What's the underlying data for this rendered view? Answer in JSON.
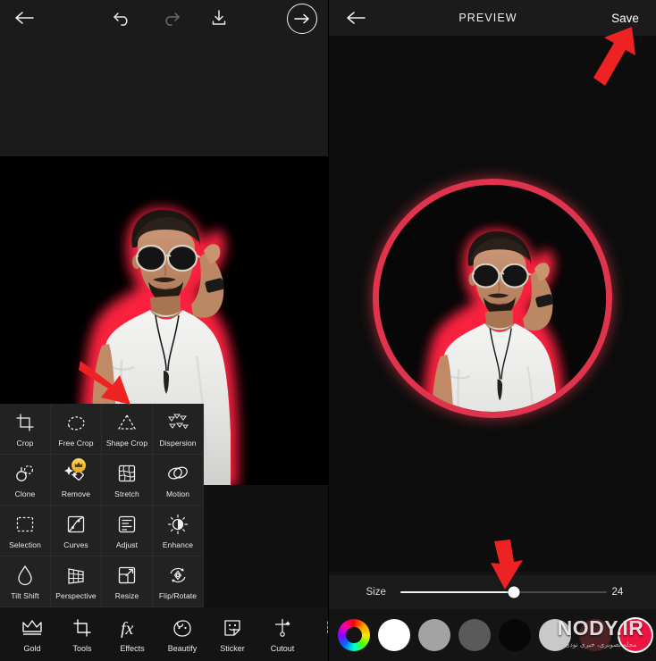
{
  "left_screen": {
    "toolbar": {
      "back_icon": "back-arrow-icon",
      "undo_icon": "undo-icon",
      "redo_icon": "redo-icon",
      "download_icon": "download-icon",
      "next_icon": "forward-arrow-circle-icon"
    },
    "tools_panel": {
      "items": [
        {
          "label": "Crop",
          "icon": "crop-icon",
          "premium": false
        },
        {
          "label": "Free Crop",
          "icon": "free-crop-icon",
          "premium": false
        },
        {
          "label": "Shape Crop",
          "icon": "shape-crop-icon",
          "premium": false
        },
        {
          "label": "Dispersion",
          "icon": "dispersion-icon",
          "premium": false
        },
        {
          "label": "Clone",
          "icon": "clone-icon",
          "premium": false
        },
        {
          "label": "Remove",
          "icon": "remove-icon",
          "premium": true
        },
        {
          "label": "Stretch",
          "icon": "stretch-icon",
          "premium": false
        },
        {
          "label": "Motion",
          "icon": "motion-icon",
          "premium": false
        },
        {
          "label": "Selection",
          "icon": "selection-icon",
          "premium": false
        },
        {
          "label": "Curves",
          "icon": "curves-icon",
          "premium": false
        },
        {
          "label": "Adjust",
          "icon": "adjust-icon",
          "premium": false
        },
        {
          "label": "Enhance",
          "icon": "enhance-icon",
          "premium": false
        },
        {
          "label": "Tilt Shift",
          "icon": "tilt-shift-icon",
          "premium": false
        },
        {
          "label": "Perspective",
          "icon": "perspective-icon",
          "premium": false
        },
        {
          "label": "Resize",
          "icon": "resize-icon",
          "premium": false
        },
        {
          "label": "Flip/Rotate",
          "icon": "flip-rotate-icon",
          "premium": false
        }
      ]
    },
    "bottom_nav": {
      "items": [
        {
          "label": "Gold",
          "icon": "crown-icon"
        },
        {
          "label": "Tools",
          "icon": "tools-icon"
        },
        {
          "label": "Effects",
          "icon": "fx-icon"
        },
        {
          "label": "Beautify",
          "icon": "beautify-icon"
        },
        {
          "label": "Sticker",
          "icon": "sticker-icon"
        },
        {
          "label": "Cutout",
          "icon": "cutout-icon"
        },
        {
          "label": "T",
          "icon": "text-icon"
        }
      ]
    }
  },
  "right_screen": {
    "header": {
      "back_icon": "back-arrow-icon",
      "title": "PREVIEW",
      "save_label": "Save"
    },
    "size_control": {
      "label": "Size",
      "value": "24",
      "percent": 55
    },
    "colors": {
      "swatches": [
        {
          "name": "color-wheel",
          "hex": "rainbow",
          "selected": false
        },
        {
          "name": "white",
          "hex": "#ffffff",
          "selected": false
        },
        {
          "name": "gray",
          "hex": "#a3a3a3",
          "selected": false
        },
        {
          "name": "dark-gray",
          "hex": "#5a5a5a",
          "selected": false
        },
        {
          "name": "black",
          "hex": "#080808",
          "selected": false
        },
        {
          "name": "light-gray",
          "hex": "#c9c9c9",
          "selected": false
        },
        {
          "name": "dark-red",
          "hex": "#4a2224",
          "selected": false
        },
        {
          "name": "crimson",
          "hex": "#ec1540",
          "selected": true
        },
        {
          "name": "maroon",
          "hex": "#4d0a10",
          "selected": false
        },
        {
          "name": "off-white",
          "hex": "#e8e8e8",
          "selected": false
        }
      ]
    }
  },
  "annotations": {
    "arrow_color": "#ee2222",
    "arrows": [
      {
        "name": "arrow-to-shape-crop",
        "direction": "down-right"
      },
      {
        "name": "arrow-to-save",
        "direction": "up-right"
      },
      {
        "name": "arrow-to-slider",
        "direction": "down"
      }
    ]
  },
  "watermark": {
    "main": "NODY.IR",
    "sub": "مجله تصویری، خبری نودی"
  },
  "theme": {
    "neon_red": "#ff2b4e",
    "ring_red": "#e0344c",
    "panel_bg": "#1b1b1b",
    "canvas_bg": "#000000"
  }
}
